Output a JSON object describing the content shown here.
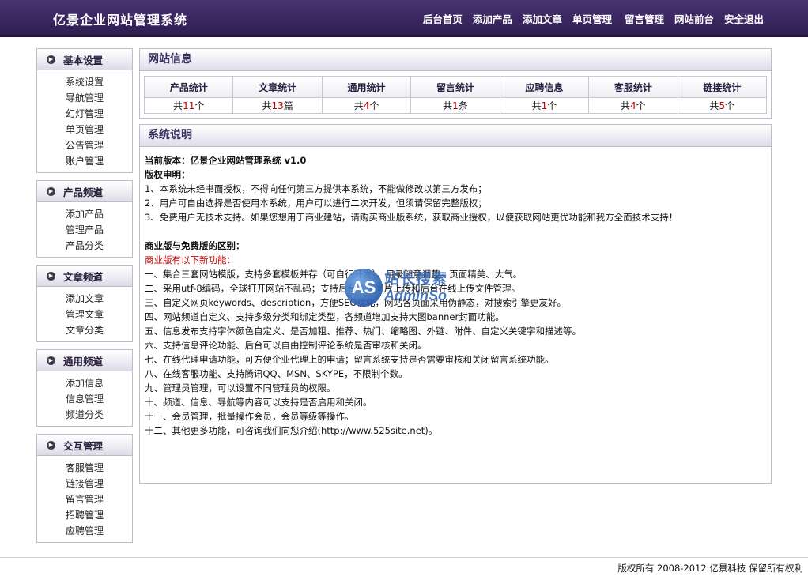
{
  "header": {
    "title": "亿景企业网站管理系统",
    "nav": [
      "后台首页",
      "添加产品",
      "添加文章",
      "单页管理",
      "留言管理",
      "网站前台",
      "安全退出"
    ]
  },
  "sidebar": [
    {
      "title": "基本设置",
      "items": [
        "系统设置",
        "导航管理",
        "幻灯管理",
        "单页管理",
        "公告管理",
        "账户管理"
      ]
    },
    {
      "title": "产品频道",
      "items": [
        "添加产品",
        "管理产品",
        "产品分类"
      ]
    },
    {
      "title": "文章频道",
      "items": [
        "添加文章",
        "管理文章",
        "文章分类"
      ]
    },
    {
      "title": "通用频道",
      "items": [
        "添加信息",
        "信息管理",
        "频道分类"
      ]
    },
    {
      "title": "交互管理",
      "items": [
        "客服管理",
        "链接管理",
        "留言管理",
        "招聘管理",
        "应聘管理"
      ]
    }
  ],
  "site_info": {
    "title": "网站信息",
    "stats": [
      {
        "label": "产品统计",
        "prefix": "共",
        "value": "11",
        "unit": "个"
      },
      {
        "label": "文章统计",
        "prefix": "共",
        "value": "13",
        "unit": "篇"
      },
      {
        "label": "通用统计",
        "prefix": "共",
        "value": "4",
        "unit": "个"
      },
      {
        "label": "留言统计",
        "prefix": "共",
        "value": "1",
        "unit": "条"
      },
      {
        "label": "应聘信息",
        "prefix": "共",
        "value": "1",
        "unit": "个"
      },
      {
        "label": "客服统计",
        "prefix": "共",
        "value": "4",
        "unit": "个"
      },
      {
        "label": "链接统计",
        "prefix": "共",
        "value": "5",
        "unit": "个"
      }
    ]
  },
  "system_desc": {
    "title": "系统说明",
    "version_line": "当前版本：亿景企业网站管理系统 v1.0",
    "copyright_heading": "版权申明：",
    "copyright_items": [
      "1、本系统未经书面授权，不得向任何第三方提供本系统，不能做修改以第三方发布；",
      "2、用户可自由选择是否使用本系统，用户可以进行二次开发，但须请保留完整版权；",
      "3、免费用户无技术支持。如果您想用于商业建站，请购买商业版系统，获取商业授权，以便获取网站更优功能和我方全面技术支持！"
    ],
    "diff_heading": "商业版与免费版的区别：",
    "new_features_label": "商业版有以下新功能：",
    "features": [
      "一、集合三套网站模版，支持多套模板并存（可自行开发），目录随意调整。页面精美、大气。",
      "二、采用utf-8编码，全球打开网站不乱码；支持后台文章图片上传和后台在线上传文件管理。",
      "三、自定义网页keywords、description，方便SEO优化，网站各页面采用伪静态，对搜索引擎更友好。",
      "四、网站频道自定义、支持多级分类和绑定类型，各频道增加支持大图banner封面功能。",
      "五、信息发布支持字体颜色自定义、是否加粗、推荐、热门、缩略图、外链、附件、自定义关键字和描述等。",
      "六、支持信息评论功能、后台可以自由控制评论系统是否审核和关闭。",
      "七、在线代理申请功能，可方便企业代理上的申请；留言系统支持是否需要审核和关闭留言系统功能。",
      "八、在线客服功能、支持腾讯QQ、MSN、SKYPE，不限制个数。",
      "九、管理员管理，可以设置不同管理员的权限。",
      "十、频道、信息、导航等内容可以支持是否启用和关闭。",
      "十一、会员管理，批量操作会员，会员等级等操作。",
      "十二、其他更多功能，可咨询我们向您介绍(http://www.525site.net)。"
    ]
  },
  "watermark": {
    "logo": "AS",
    "cn": "站长搜索",
    "en": "AdminSo"
  },
  "footer": {
    "text": "版权所有 2008-2012 亿景科技 保留所有权利"
  },
  "colors": {
    "header_bg": "#3a2760",
    "accent_red": "#c00000",
    "border": "#bdbdc9"
  },
  "icons": {
    "sidebar_head": "circle-arrow-icon"
  }
}
